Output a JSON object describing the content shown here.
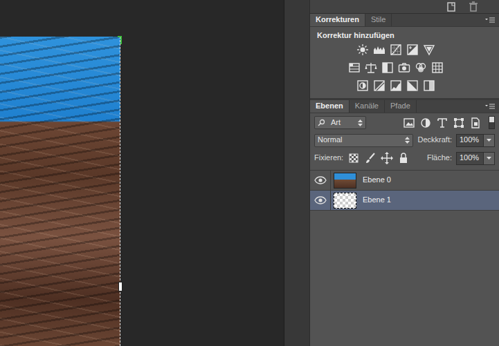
{
  "canvas": {
    "selection": true
  },
  "adjustments_panel": {
    "tabs": [
      {
        "label": "Korrekturen",
        "selected": true
      },
      {
        "label": "Stile",
        "selected": false
      }
    ],
    "title": "Korrektur hinzufügen"
  },
  "layers_panel": {
    "tabs": [
      {
        "label": "Ebenen",
        "selected": true
      },
      {
        "label": "Kanäle",
        "selected": false
      },
      {
        "label": "Pfade",
        "selected": false
      }
    ],
    "filter": {
      "label": "Art",
      "enabled": true
    },
    "blend_mode": "Normal",
    "opacity_label": "Deckkraft:",
    "opacity": "100%",
    "lock_label": "Fixieren:",
    "fill_label": "Fläche:",
    "fill": "100%",
    "layers": [
      {
        "name": "Ebene 0",
        "visible": true,
        "selected": false,
        "kind": "image"
      },
      {
        "name": "Ebene 1",
        "visible": true,
        "selected": true,
        "kind": "empty"
      }
    ]
  }
}
